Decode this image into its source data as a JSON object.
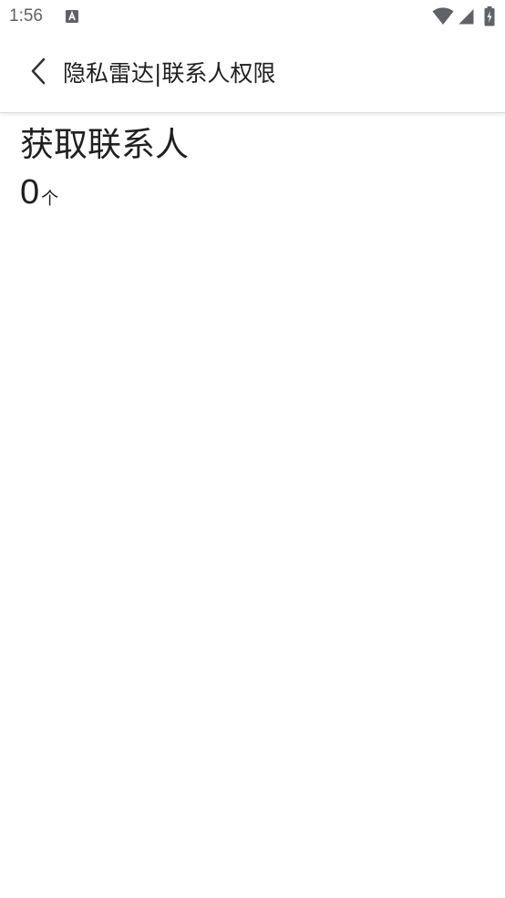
{
  "status_bar": {
    "time": "1:56",
    "notification_icon": "text-a-icon",
    "wifi_icon": "wifi-icon",
    "signal_icon": "signal-icon",
    "battery_icon": "battery-charging-icon"
  },
  "app_bar": {
    "back_icon": "chevron-left-icon",
    "title": "隐私雷达|联系人权限"
  },
  "content": {
    "section_title": "获取联系人",
    "count_value": "0",
    "count_unit": "个"
  },
  "colors": {
    "background": "#ffffff",
    "text": "#202020",
    "status_icons": "#5f6368"
  }
}
